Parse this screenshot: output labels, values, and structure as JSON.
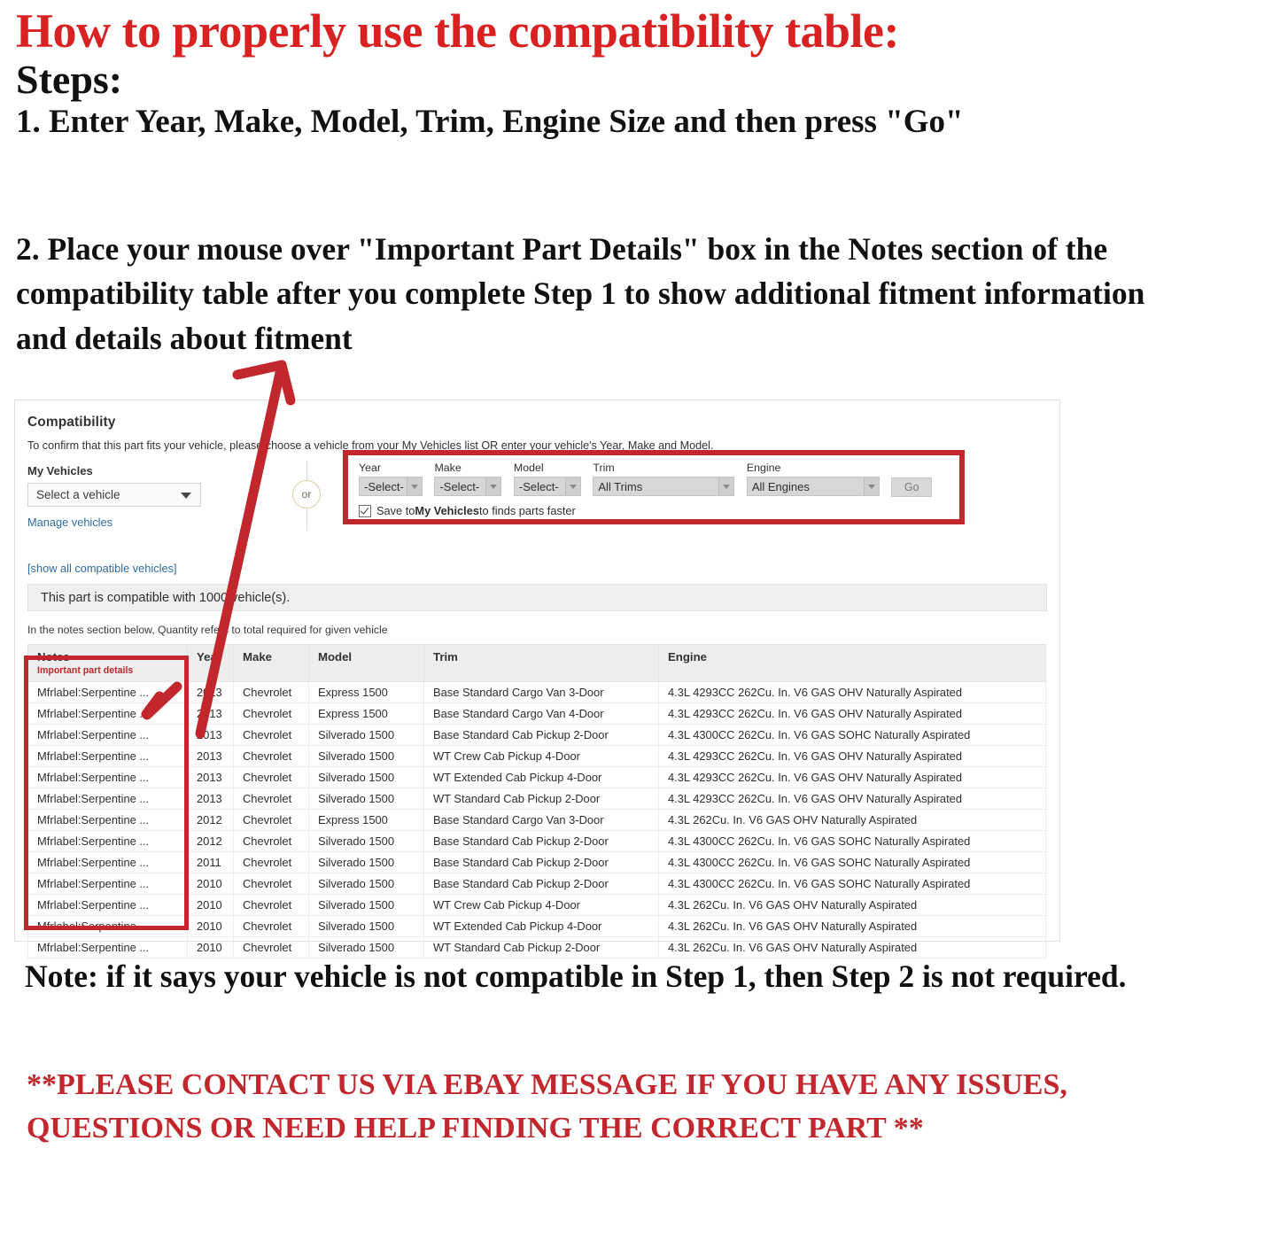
{
  "instructions": {
    "title": "How to properly use the compatibility table:",
    "steps_label": "Steps:",
    "step_one": "1. Enter Year, Make, Model, Trim, Engine Size and then press \"Go\"",
    "step_two": "2. Place your mouse over \"Important Part Details\" box in the Notes section of the compatibility table after you complete Step 1 to show additional fitment information and details about fitment",
    "bottom_note": "Note: if it says your vehicle is not compatible in Step 1, then Step 2 is not required.",
    "contact_note": "**PLEASE CONTACT US VIA EBAY MESSAGE IF YOU HAVE ANY ISSUES, QUESTIONS OR NEED HELP FINDING THE CORRECT PART **"
  },
  "panel": {
    "heading": "Compatibility",
    "description": "To confirm that this part fits your vehicle, please choose a vehicle from your My Vehicles list OR enter your vehicle's Year, Make and Model.",
    "my_vehicles": {
      "label": "My Vehicles",
      "select_value": "Select a vehicle",
      "manage_link": "Manage vehicles"
    },
    "or_label": "or",
    "ymm": {
      "year": {
        "label": "Year",
        "value": "-Select-"
      },
      "make": {
        "label": "Make",
        "value": "-Select-"
      },
      "model": {
        "label": "Model",
        "value": "-Select-"
      },
      "trim": {
        "label": "Trim",
        "value": "All Trims"
      },
      "engine": {
        "label": "Engine",
        "value": "All Engines"
      },
      "go_label": "Go",
      "save_prefix": "Save to ",
      "save_bold": "My Vehicles",
      "save_suffix": " to finds parts faster"
    },
    "show_all_link": "[show all compatible vehicles]",
    "compat_banner": "This part is compatible with 1000 vehicle(s).",
    "qty_note": "In the notes section below, Quantity refers to total required for given vehicle",
    "table": {
      "headers": {
        "notes": "Notes",
        "notes_sub": "Important part details",
        "year": "Year",
        "make": "Make",
        "model": "Model",
        "trim": "Trim",
        "engine": "Engine"
      },
      "rows": [
        {
          "notes": "Mfrlabel:Serpentine ...",
          "year": "2013",
          "make": "Chevrolet",
          "model": "Express 1500",
          "trim": "Base Standard Cargo Van 3-Door",
          "engine": "4.3L 4293CC 262Cu. In. V6 GAS OHV Naturally Aspirated"
        },
        {
          "notes": "Mfrlabel:Serpentine ...",
          "year": "2013",
          "make": "Chevrolet",
          "model": "Express 1500",
          "trim": "Base Standard Cargo Van 4-Door",
          "engine": "4.3L 4293CC 262Cu. In. V6 GAS OHV Naturally Aspirated"
        },
        {
          "notes": "Mfrlabel:Serpentine ...",
          "year": "2013",
          "make": "Chevrolet",
          "model": "Silverado 1500",
          "trim": "Base Standard Cab Pickup 2-Door",
          "engine": "4.3L 4300CC 262Cu. In. V6 GAS SOHC Naturally Aspirated"
        },
        {
          "notes": "Mfrlabel:Serpentine ...",
          "year": "2013",
          "make": "Chevrolet",
          "model": "Silverado 1500",
          "trim": "WT Crew Cab Pickup 4-Door",
          "engine": "4.3L 4293CC 262Cu. In. V6 GAS OHV Naturally Aspirated"
        },
        {
          "notes": "Mfrlabel:Serpentine ...",
          "year": "2013",
          "make": "Chevrolet",
          "model": "Silverado 1500",
          "trim": "WT Extended Cab Pickup 4-Door",
          "engine": "4.3L 4293CC 262Cu. In. V6 GAS OHV Naturally Aspirated"
        },
        {
          "notes": "Mfrlabel:Serpentine ...",
          "year": "2013",
          "make": "Chevrolet",
          "model": "Silverado 1500",
          "trim": "WT Standard Cab Pickup 2-Door",
          "engine": "4.3L 4293CC 262Cu. In. V6 GAS OHV Naturally Aspirated"
        },
        {
          "notes": "Mfrlabel:Serpentine ...",
          "year": "2012",
          "make": "Chevrolet",
          "model": "Express 1500",
          "trim": "Base Standard Cargo Van 3-Door",
          "engine": "4.3L 262Cu. In. V6 GAS OHV Naturally Aspirated"
        },
        {
          "notes": "Mfrlabel:Serpentine ...",
          "year": "2012",
          "make": "Chevrolet",
          "model": "Silverado 1500",
          "trim": "Base Standard Cab Pickup 2-Door",
          "engine": "4.3L 4300CC 262Cu. In. V6 GAS SOHC Naturally Aspirated"
        },
        {
          "notes": "Mfrlabel:Serpentine ...",
          "year": "2011",
          "make": "Chevrolet",
          "model": "Silverado 1500",
          "trim": "Base Standard Cab Pickup 2-Door",
          "engine": "4.3L 4300CC 262Cu. In. V6 GAS SOHC Naturally Aspirated"
        },
        {
          "notes": "Mfrlabel:Serpentine ...",
          "year": "2010",
          "make": "Chevrolet",
          "model": "Silverado 1500",
          "trim": "Base Standard Cab Pickup 2-Door",
          "engine": "4.3L 4300CC 262Cu. In. V6 GAS SOHC Naturally Aspirated"
        },
        {
          "notes": "Mfrlabel:Serpentine ...",
          "year": "2010",
          "make": "Chevrolet",
          "model": "Silverado 1500",
          "trim": "WT Crew Cab Pickup 4-Door",
          "engine": "4.3L 262Cu. In. V6 GAS OHV Naturally Aspirated"
        },
        {
          "notes": "Mfrlabel:Serpentine ...",
          "year": "2010",
          "make": "Chevrolet",
          "model": "Silverado 1500",
          "trim": "WT Extended Cab Pickup 4-Door",
          "engine": "4.3L 262Cu. In. V6 GAS OHV Naturally Aspirated"
        },
        {
          "notes": "Mfrlabel:Serpentine ...",
          "year": "2010",
          "make": "Chevrolet",
          "model": "Silverado 1500",
          "trim": "WT Standard Cab Pickup 2-Door",
          "engine": "4.3L 262Cu. In. V6 GAS OHV Naturally Aspirated"
        }
      ]
    }
  },
  "colors": {
    "accent_red": "#c1272d",
    "title_red": "#d92121",
    "link_blue": "#2d6ca2"
  }
}
